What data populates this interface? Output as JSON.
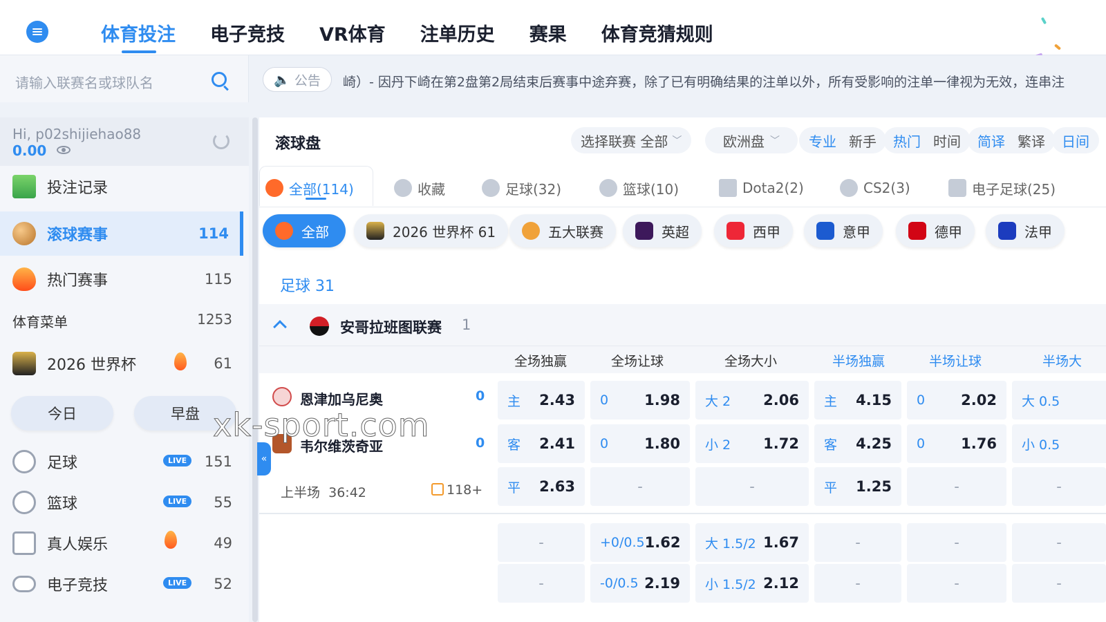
{
  "nav": {
    "items": [
      {
        "label": "体育投注",
        "active": true
      },
      {
        "label": "电子竞技"
      },
      {
        "label": "VR体育"
      },
      {
        "label": "注单历史"
      },
      {
        "label": "赛果"
      },
      {
        "label": "体育竞猜规则"
      }
    ]
  },
  "search": {
    "placeholder": "请输入联赛名或球队名"
  },
  "notice": {
    "badge": "公告",
    "text": "崎）- 因丹下崎在第2盘第2局结束后赛事中途弃赛，除了已有明确结果的注单以外，所有受影响的注单一律视为无效，连串注"
  },
  "user": {
    "greeting": "Hi, p02shijiehao88",
    "balance": "0.00"
  },
  "sidebar": {
    "bet_records": "投注记录",
    "live_label": "滚球赛事",
    "live_count": "114",
    "hot_label": "热门赛事",
    "hot_count": "115",
    "menu_label": "体育菜单",
    "menu_count": "1253",
    "worldcup_label": "2026 世界杯",
    "worldcup_count": "61",
    "today": "今日",
    "early": "早盘",
    "sports": [
      {
        "label": "足球",
        "badge": "LIVE",
        "count": "151"
      },
      {
        "label": "篮球",
        "badge": "LIVE",
        "count": "55"
      },
      {
        "label": "真人娱乐",
        "badge": "",
        "count": "49"
      },
      {
        "label": "电子竞技",
        "badge": "LIVE",
        "count": "52"
      }
    ]
  },
  "main": {
    "title": "滚球盘",
    "filters": {
      "league_select": "选择联赛  全部",
      "odds_type": "欧洲盘",
      "pro": "专业",
      "novice": "新手",
      "hot": "热门",
      "time": "时间",
      "simplified": "简译",
      "traditional": "繁译",
      "date": "日间"
    },
    "tabs": [
      {
        "label": "全部(114)",
        "active": true
      },
      {
        "label": "收藏"
      },
      {
        "label": "足球(32)"
      },
      {
        "label": "篮球(10)"
      },
      {
        "label": "Dota2(2)"
      },
      {
        "label": "CS2(3)"
      },
      {
        "label": "电子足球(25)"
      }
    ],
    "league_chips": [
      {
        "label": "全部",
        "active": true
      },
      {
        "label": "2026 世界杯 61"
      },
      {
        "label": "五大联赛"
      },
      {
        "label": "英超"
      },
      {
        "label": "西甲"
      },
      {
        "label": "意甲"
      },
      {
        "label": "德甲"
      },
      {
        "label": "法甲"
      }
    ],
    "section_title": "足球 31",
    "league": {
      "name": "安哥拉班图联赛",
      "count": "1"
    },
    "columns": [
      "全场独赢",
      "全场让球",
      "全场大小",
      "半场独赢",
      "半场让球",
      "半场大"
    ],
    "match": {
      "home": "恩津加乌尼奥",
      "away": "韦尔维茨奇亚",
      "home_score": "0",
      "away_score": "0",
      "period": "上半场",
      "clock": "36:42",
      "more": "118+",
      "rows": [
        {
          "ft1x2_k": "主",
          "ft1x2_v": "2.43",
          "fth_k": "0",
          "fth_v": "1.98",
          "ftou_k": "大 2",
          "ftou_v": "2.06",
          "ht1x2_k": "主",
          "ht1x2_v": "4.15",
          "hth_k": "0",
          "hth_v": "2.02",
          "htou_k": "大 0.5"
        },
        {
          "ft1x2_k": "客",
          "ft1x2_v": "2.41",
          "fth_k": "0",
          "fth_v": "1.80",
          "ftou_k": "小 2",
          "ftou_v": "1.72",
          "ht1x2_k": "客",
          "ht1x2_v": "4.25",
          "hth_k": "0",
          "hth_v": "1.76",
          "htou_k": "小 0.5"
        },
        {
          "ft1x2_k": "平",
          "ft1x2_v": "2.63",
          "ht1x2_k": "平",
          "ht1x2_v": "1.25"
        }
      ],
      "extra_rows": [
        {
          "fth_k": "+0/0.5",
          "fth_v": "1.62",
          "ftou_k": "大 1.5/2",
          "ftou_v": "1.67"
        },
        {
          "fth_k": "-0/0.5",
          "fth_v": "2.19",
          "ftou_k": "小 1.5/2",
          "ftou_v": "2.12"
        }
      ],
      "dash": "-"
    }
  },
  "watermark": "xk-sport.com",
  "colors": {
    "accent": "#2f8cf0",
    "bg": "#eef2f8"
  }
}
